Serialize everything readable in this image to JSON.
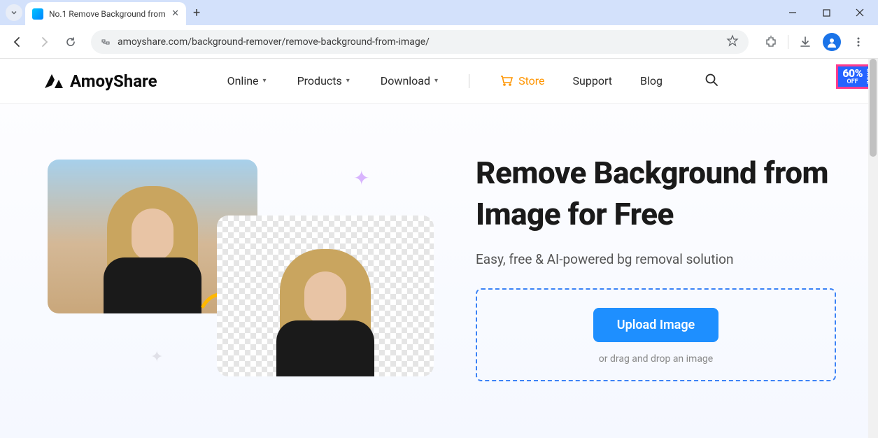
{
  "browser": {
    "tab_title": "No.1 Remove Background from",
    "url": "amoyshare.com/background-remover/remove-background-from-image/"
  },
  "header": {
    "logo_text": "AmoyShare",
    "nav": {
      "online": "Online",
      "products": "Products",
      "download": "Download",
      "store": "Store",
      "support": "Support",
      "blog": "Blog"
    },
    "sale": {
      "percent": "60%",
      "off": "OFF",
      "side": "SALE"
    }
  },
  "hero": {
    "title": "Remove Background from Image for Free",
    "subtitle": "Easy, free & AI-powered bg removal solution",
    "upload_button": "Upload Image",
    "drag_text": "or drag and drop an image"
  }
}
